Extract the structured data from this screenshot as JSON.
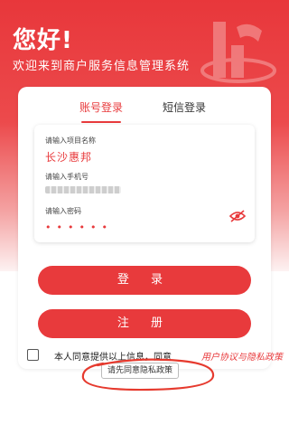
{
  "header": {
    "greeting": "您好!",
    "subtitle": "欢迎来到商户服务信息管理系统"
  },
  "tabs": [
    {
      "label": "账号登录",
      "active": true
    },
    {
      "label": "短信登录",
      "active": false
    }
  ],
  "form": {
    "project": {
      "label": "请输入项目名称",
      "value": "长沙惠邦"
    },
    "phone": {
      "label": "请输入手机号",
      "value_blurred": true
    },
    "password": {
      "label": "请输入密码",
      "masked_value": "••••••",
      "toggle_icon": "eye-off-icon"
    }
  },
  "buttons": {
    "login_label": "登 录",
    "register_label": "注 册"
  },
  "agreement": {
    "text": "本人同意提供以上信息，同意",
    "link": "用户协议与隐私政策",
    "checked": false
  },
  "toast": {
    "message": "请先同意隐私政策"
  },
  "colors": {
    "brand_red": "#e83a3c",
    "annotation_circle": "#e63a2e"
  }
}
